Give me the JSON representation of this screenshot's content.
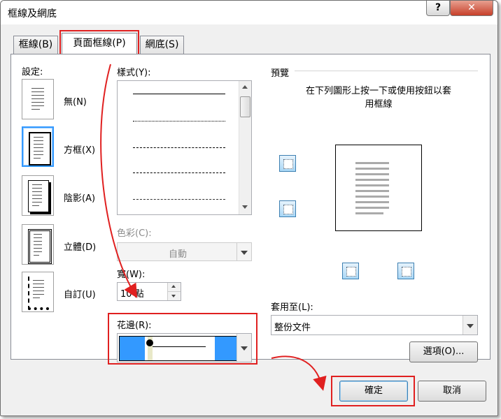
{
  "window": {
    "title": "框線及網底",
    "help_label": "?",
    "close_label": "✕"
  },
  "tabs": [
    {
      "label": "框線(B)",
      "active": false
    },
    {
      "label": "頁面框線(P)",
      "active": true
    },
    {
      "label": "網底(S)",
      "active": false
    }
  ],
  "settings": {
    "label": "設定:",
    "presets": [
      {
        "label": "無(N)",
        "selected": false
      },
      {
        "label": "方框(X)",
        "selected": true
      },
      {
        "label": "陰影(A)",
        "selected": false
      },
      {
        "label": "立體(D)",
        "selected": false
      },
      {
        "label": "自訂(U)",
        "selected": false
      }
    ]
  },
  "style": {
    "label": "樣式(Y):"
  },
  "color": {
    "label": "色彩(C):",
    "value": "自動"
  },
  "width": {
    "label": "寬(W):",
    "value": "10 點"
  },
  "art": {
    "label": "花邊(R):"
  },
  "preview": {
    "label": "預覽",
    "hint": "在下列圖形上按一下或使用按鈕以套用框線"
  },
  "apply_to": {
    "label": "套用至(L):",
    "value": "整份文件"
  },
  "buttons": {
    "options": "選項(O)...",
    "ok": "確定",
    "cancel": "取消"
  },
  "colors": {
    "highlight": "#e02020",
    "selection": "#3399ff",
    "art_blue": "#3399ff"
  }
}
